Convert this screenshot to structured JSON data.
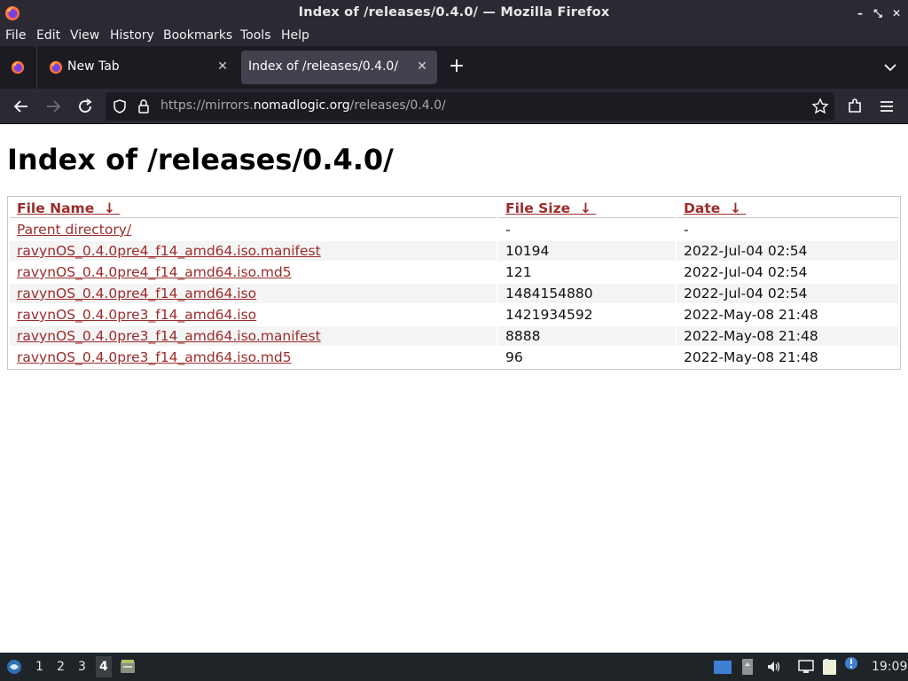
{
  "window": {
    "title": "Index of /releases/0.4.0/ — Mozilla Firefox",
    "controls": [
      "minimize-icon",
      "maximize-icon",
      "close-icon"
    ]
  },
  "menu": [
    {
      "label": "File"
    },
    {
      "label": "Edit"
    },
    {
      "label": "View"
    },
    {
      "label": "History"
    },
    {
      "label": "Bookmarks"
    },
    {
      "label": "Tools"
    },
    {
      "label": "Help"
    }
  ],
  "tabs": [
    {
      "label": "New Tab",
      "active": false
    },
    {
      "label": "Index of /releases/0.4.0/",
      "active": true
    }
  ],
  "urlbar": {
    "scheme": "https://mirrors.",
    "host": "nomadlogic.org",
    "path": "/releases/0.4.0/"
  },
  "page": {
    "heading": "Index of /releases/0.4.0/",
    "columns": [
      {
        "label": "File Name",
        "sort": "↓"
      },
      {
        "label": "File Size",
        "sort": "↓"
      },
      {
        "label": "Date",
        "sort": "↓"
      }
    ],
    "rows": [
      {
        "name": "Parent directory/",
        "size": "-",
        "date": "-"
      },
      {
        "name": "ravynOS_0.4.0pre4_f14_amd64.iso.manifest",
        "size": "10194",
        "date": "2022-Jul-04 02:54"
      },
      {
        "name": "ravynOS_0.4.0pre4_f14_amd64.iso.md5",
        "size": "121",
        "date": "2022-Jul-04 02:54"
      },
      {
        "name": "ravynOS_0.4.0pre4_f14_amd64.iso",
        "size": "1484154880",
        "date": "2022-Jul-04 02:54"
      },
      {
        "name": "ravynOS_0.4.0pre3_f14_amd64.iso",
        "size": "1421934592",
        "date": "2022-May-08 21:48"
      },
      {
        "name": "ravynOS_0.4.0pre3_f14_amd64.iso.manifest",
        "size": "8888",
        "date": "2022-May-08 21:48"
      },
      {
        "name": "ravynOS_0.4.0pre3_f14_amd64.iso.md5",
        "size": "96",
        "date": "2022-May-08 21:48"
      }
    ]
  },
  "taskbar": {
    "workspaces": [
      "1",
      "2",
      "3",
      "4"
    ],
    "active_workspace": "4",
    "clock": "19:09"
  },
  "colors": {
    "link": "#9b2c2c",
    "chrome_dark": "#2b2a33",
    "tabstrip": "#1c1b22",
    "active_tab": "#42414d",
    "taskbar": "#1f2428"
  }
}
